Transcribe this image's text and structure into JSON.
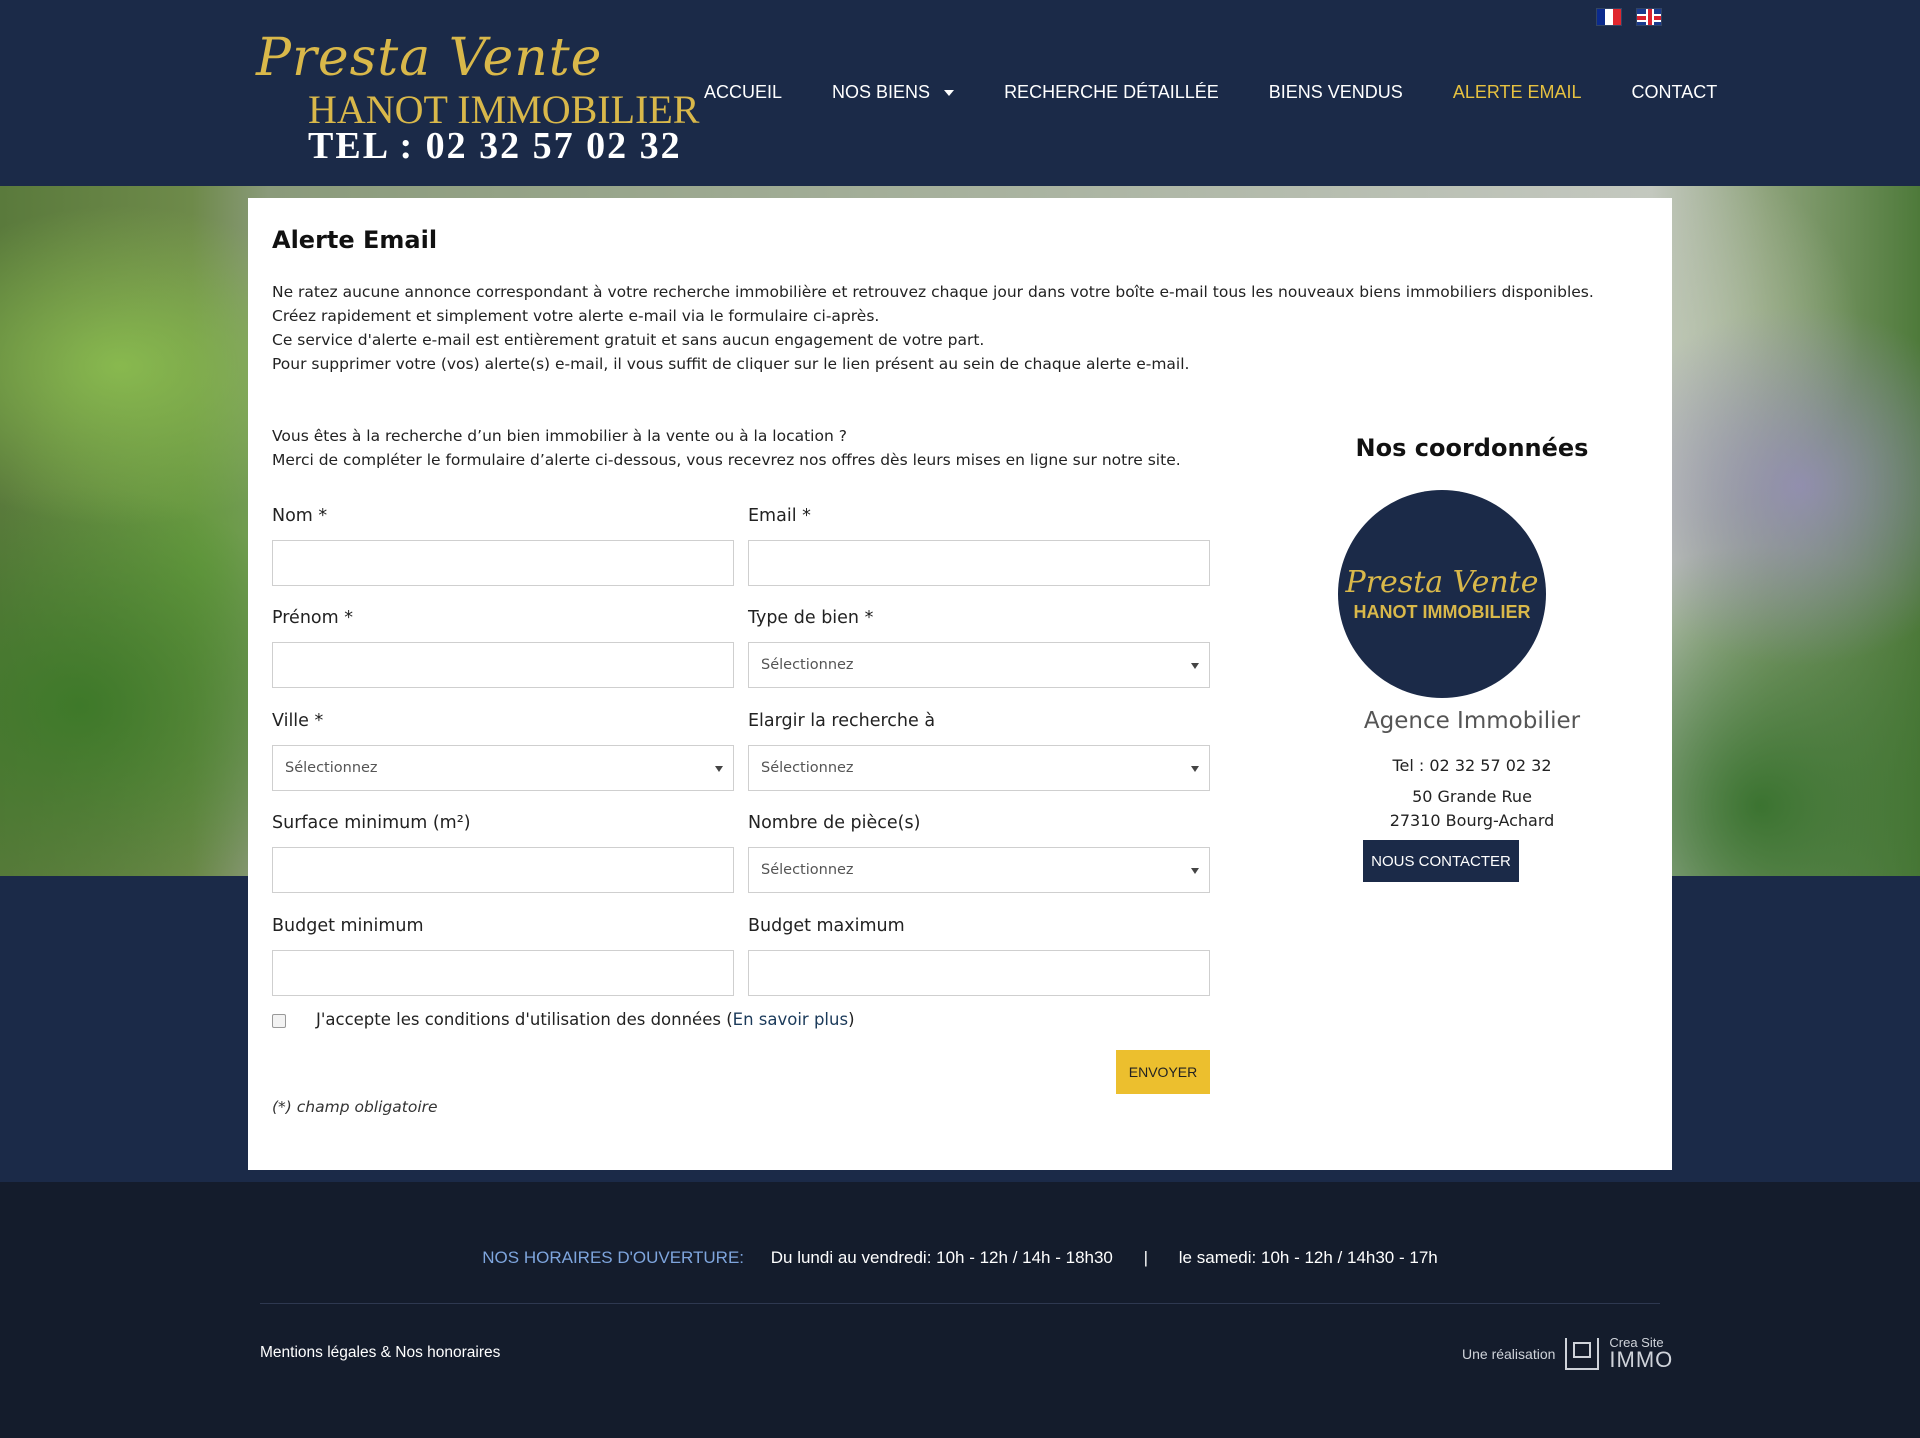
{
  "header": {
    "logo_script": "Presta Vente",
    "logo_company": "HANOT IMMOBILIER",
    "logo_tel": "TEL : 02 32 57 02 32",
    "nav": [
      {
        "label": "ACCUEIL"
      },
      {
        "label": "NOS BIENS"
      },
      {
        "label": "RECHERCHE DÉTAILLÉE"
      },
      {
        "label": "BIENS VENDUS"
      },
      {
        "label": "ALERTE EMAIL"
      },
      {
        "label": "CONTACT"
      }
    ],
    "active_nav": "ALERTE EMAIL"
  },
  "main": {
    "title": "Alerte Email",
    "intro": [
      "Ne ratez aucune annonce correspondant à votre recherche immobilière et retrouvez chaque jour dans votre boîte e-mail tous les nouveaux biens immobiliers disponibles.",
      "Créez rapidement et simplement votre alerte e-mail via le formulaire ci-après.",
      "Ce service d'alerte e-mail est entièrement gratuit et sans aucun engagement de votre part.",
      "Pour supprimer votre (vos) alerte(s) e-mail, il vous suffit de cliquer sur le lien présent au sein de chaque alerte e-mail."
    ],
    "lead": [
      "Vous êtes à la recherche d’un bien immobilier à la vente ou à la location ?",
      "Merci de compléter le formulaire d’alerte ci-dessous, vous recevrez nos offres dès leurs mises en ligne sur notre site."
    ]
  },
  "form": {
    "nom_label": "Nom *",
    "email_label": "Email *",
    "prenom_label": "Prénom *",
    "type_label": "Type de bien *",
    "type_value": "Sélectionnez",
    "ville_label": "Ville *",
    "ville_value": "Sélectionnez",
    "elargir_label": "Elargir la recherche à",
    "elargir_value": "Sélectionnez",
    "surface_label": "Surface minimum (m²)",
    "pieces_label": "Nombre de pièce(s)",
    "pieces_value": "Sélectionnez",
    "budget_min_label": "Budget minimum",
    "budget_max_label": "Budget maximum",
    "consent_text": "J'accepte les conditions d'utilisation des données (",
    "consent_link": "En savoir plus",
    "consent_end": ")",
    "submit": "ENVOYER",
    "required_note": "(*) champ obligatoire"
  },
  "sidebar": {
    "title": "Nos coordonnées",
    "logo_script": "Presta Vente",
    "logo_company": "HANOT IMMOBILIER",
    "agency": "Agence Immobilier",
    "tel": "Tel : 02 32 57 02 32",
    "address_line1": "50 Grande Rue",
    "address_line2": "27310 Bourg-Achard",
    "contact_button": "NOUS CONTACTER"
  },
  "footer": {
    "hours_label": "NOS HORAIRES D'OUVERTURE:",
    "hours_week": "Du lundi au vendredi: 10h - 12h / 14h - 18h30",
    "separator": "|",
    "hours_sat": "le samedi: 10h - 12h / 14h30 - 17h",
    "links": "Mentions légales & Nos honoraires",
    "credit_label": "Une réalisation",
    "credit_brand_top": "Crea Site",
    "credit_brand_bottom": "IMMO"
  },
  "colors": {
    "navy": "#1b2a48",
    "accent_gold": "#e6c140",
    "button_yellow": "#ecbf2e",
    "footer_bg": "#141c2c",
    "hours_label": "#7ea5dd"
  }
}
